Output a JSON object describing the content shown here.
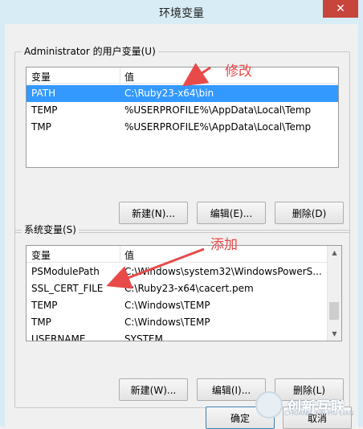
{
  "window": {
    "title": "环境变量",
    "close_glyph": "✕"
  },
  "user_vars": {
    "group_label": "Administrator 的用户变量(U)",
    "columns": [
      "变量",
      "值"
    ],
    "rows": [
      {
        "name": "PATH",
        "value": "C:\\Ruby23-x64\\bin",
        "selected": true
      },
      {
        "name": "TEMP",
        "value": "%USERPROFILE%\\AppData\\Local\\Temp",
        "selected": false
      },
      {
        "name": "TMP",
        "value": "%USERPROFILE%\\AppData\\Local\\Temp",
        "selected": false
      }
    ],
    "buttons": {
      "new": "新建(N)...",
      "edit": "编辑(E)...",
      "delete": "删除(D)"
    }
  },
  "system_vars": {
    "group_label": "系统变量(S)",
    "columns": [
      "变量",
      "值"
    ],
    "rows": [
      {
        "name": "PSModulePath",
        "value": "C:\\Windows\\system32\\WindowsPowerS..."
      },
      {
        "name": "SSL_CERT_FILE",
        "value": "C:\\Ruby23-x64\\cacert.pem"
      },
      {
        "name": "TEMP",
        "value": "C:\\Windows\\TEMP"
      },
      {
        "name": "TMP",
        "value": "C:\\Windows\\TEMP"
      },
      {
        "name": "USERNAME",
        "value": "SYSTEM"
      }
    ],
    "buttons": {
      "new": "新建(W)...",
      "edit": "编辑(I)...",
      "delete": "删除(L)"
    }
  },
  "footer": {
    "ok": "确定",
    "cancel": "取消"
  },
  "annotations": {
    "modify": "修改",
    "add": "添加",
    "color": "#e84a4a"
  },
  "watermark": {
    "text": "创新互联",
    "sub": "CHUANG XIN HU LIAN"
  },
  "colors": {
    "selection": "#3399ff",
    "close": "#c7453b",
    "titlebar": "#d7ecf5"
  }
}
